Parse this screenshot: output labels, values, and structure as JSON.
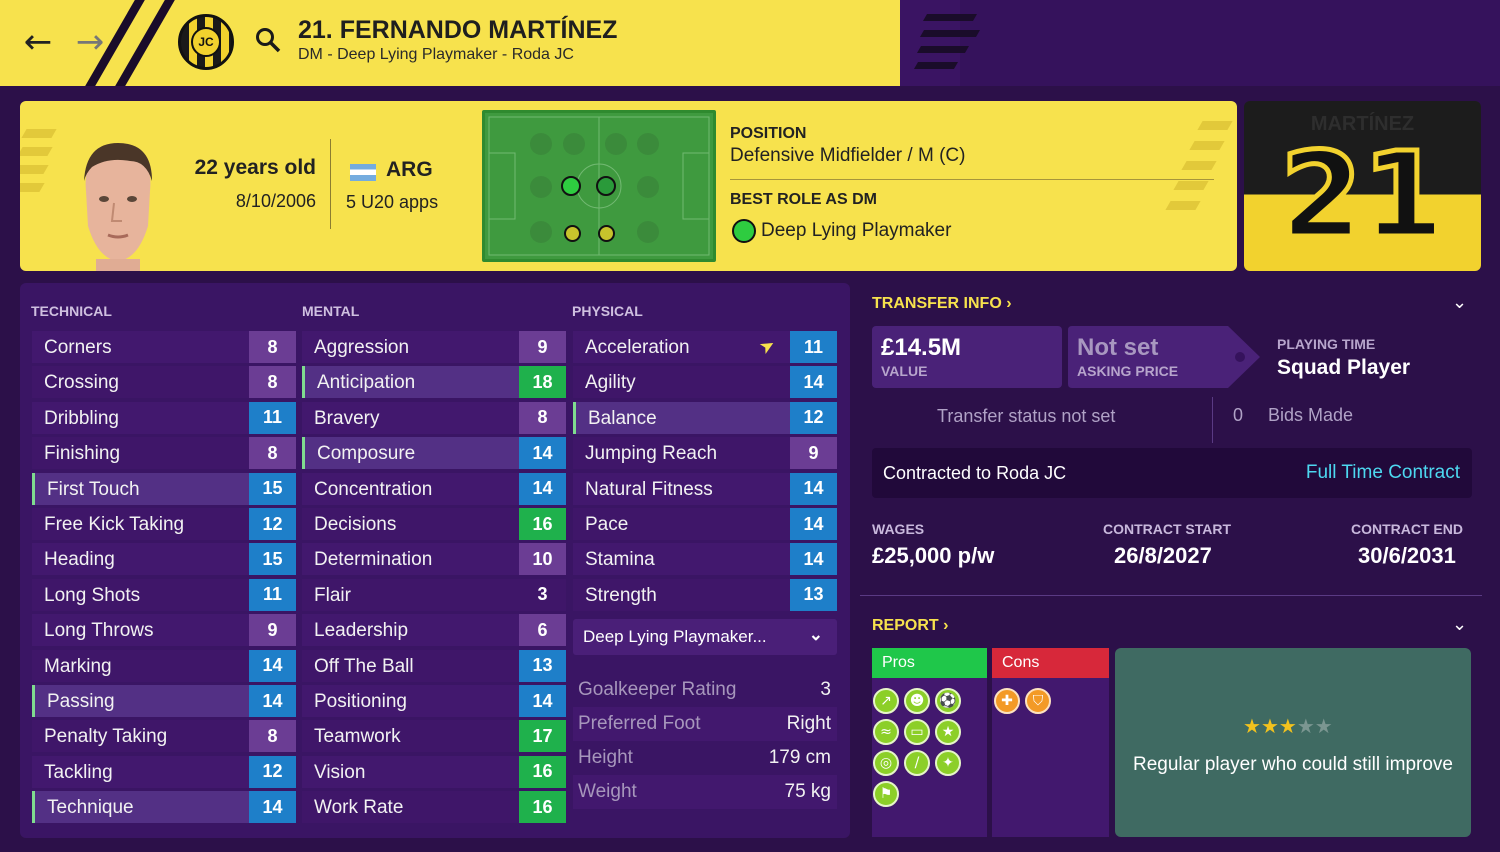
{
  "header": {
    "title": "21. FERNANDO MARTÍNEZ",
    "subtitle": "DM - Deep Lying Playmaker - Roda JC",
    "club_badge_text": "JC",
    "back_icon": "arrow-left-icon",
    "forward_icon": "arrow-right-icon",
    "search_icon": "search-icon"
  },
  "profile": {
    "age": "22 years old",
    "dob": "8/10/2006",
    "nationality": "ARG",
    "apps": "5 U20 apps",
    "position_label": "POSITION",
    "position_value": "Defensive Midfielder / M (C)",
    "best_role_label": "BEST ROLE AS DM",
    "best_role_value": "Deep Lying Playmaker"
  },
  "kit": {
    "name": "MARTÍNEZ",
    "number": "21"
  },
  "attributes": {
    "technical_label": "TECHNICAL",
    "mental_label": "MENTAL",
    "physical_label": "PHYSICAL",
    "technical": [
      {
        "name": "Corners",
        "value": "8"
      },
      {
        "name": "Crossing",
        "value": "8"
      },
      {
        "name": "Dribbling",
        "value": "11"
      },
      {
        "name": "Finishing",
        "value": "8"
      },
      {
        "name": "First Touch",
        "value": "15"
      },
      {
        "name": "Free Kick Taking",
        "value": "12"
      },
      {
        "name": "Heading",
        "value": "15"
      },
      {
        "name": "Long Shots",
        "value": "11"
      },
      {
        "name": "Long Throws",
        "value": "9"
      },
      {
        "name": "Marking",
        "value": "14"
      },
      {
        "name": "Passing",
        "value": "14"
      },
      {
        "name": "Penalty Taking",
        "value": "8"
      },
      {
        "name": "Tackling",
        "value": "12"
      },
      {
        "name": "Technique",
        "value": "14"
      }
    ],
    "mental": [
      {
        "name": "Aggression",
        "value": "9"
      },
      {
        "name": "Anticipation",
        "value": "18"
      },
      {
        "name": "Bravery",
        "value": "8"
      },
      {
        "name": "Composure",
        "value": "14"
      },
      {
        "name": "Concentration",
        "value": "14"
      },
      {
        "name": "Decisions",
        "value": "16"
      },
      {
        "name": "Determination",
        "value": "10"
      },
      {
        "name": "Flair",
        "value": "3"
      },
      {
        "name": "Leadership",
        "value": "6"
      },
      {
        "name": "Off The Ball",
        "value": "13"
      },
      {
        "name": "Positioning",
        "value": "14"
      },
      {
        "name": "Teamwork",
        "value": "17"
      },
      {
        "name": "Vision",
        "value": "16"
      },
      {
        "name": "Work Rate",
        "value": "16"
      }
    ],
    "physical": [
      {
        "name": "Acceleration",
        "value": "11"
      },
      {
        "name": "Agility",
        "value": "14"
      },
      {
        "name": "Balance",
        "value": "12"
      },
      {
        "name": "Jumping Reach",
        "value": "9"
      },
      {
        "name": "Natural Fitness",
        "value": "14"
      },
      {
        "name": "Pace",
        "value": "14"
      },
      {
        "name": "Stamina",
        "value": "14"
      },
      {
        "name": "Strength",
        "value": "13"
      }
    ],
    "role_select": "Deep Lying Playmaker...",
    "info": [
      {
        "key": "Goalkeeper Rating",
        "value": "3"
      },
      {
        "key": "Preferred Foot",
        "value": "Right"
      },
      {
        "key": "Height",
        "value": "179 cm"
      },
      {
        "key": "Weight",
        "value": "75 kg"
      }
    ]
  },
  "transfer": {
    "heading": "TRANSFER INFO",
    "value": "£14.5M",
    "value_label": "VALUE",
    "asking": "Not set",
    "asking_label": "ASKING PRICE",
    "playing_time_label": "PLAYING TIME",
    "playing_time": "Squad Player",
    "status": "Transfer status not set",
    "bids_count": "0",
    "bids_label": "Bids Made",
    "contracted": "Contracted to Roda JC",
    "contract_type": "Full Time Contract",
    "wages_label": "WAGES",
    "wages": "£25,000 p/w",
    "start_label": "CONTRACT START",
    "start": "26/8/2027",
    "end_label": "CONTRACT END",
    "end": "30/6/2031"
  },
  "report": {
    "heading": "REPORT",
    "pros_label": "Pros",
    "cons_label": "Cons",
    "potential_text": "Regular player who could still improve",
    "stars_rating": 3,
    "stars_max": 5
  },
  "colors": {
    "accent_yellow": "#f7e24d",
    "bg_purple": "#2c1049",
    "attr_green": "#1fb14c",
    "attr_blue": "#1e7fc9",
    "attr_purple": "#6b3d94",
    "link_cyan": "#4dd8f0"
  }
}
